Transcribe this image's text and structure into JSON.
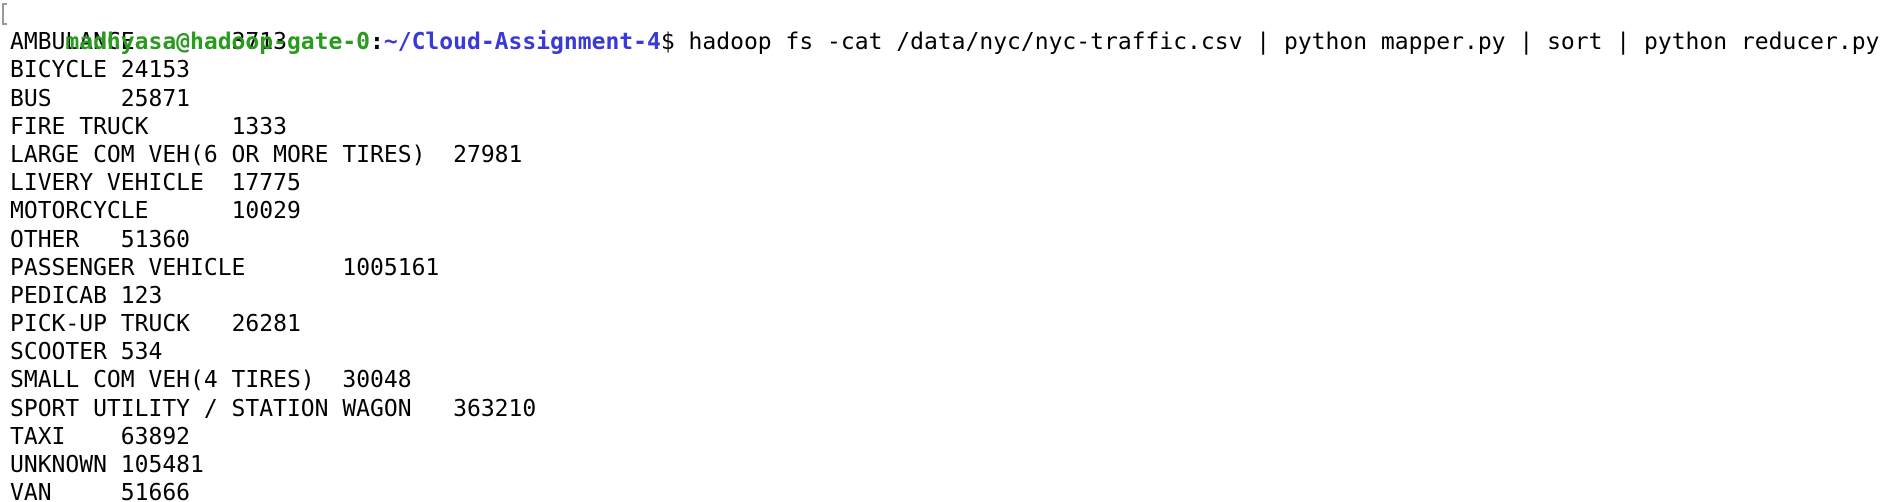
{
  "prompt": {
    "user_host": "madhyasa@hadoop-gate-0",
    "separator": ":",
    "cwd": "~/Cloud-Assignment-4",
    "symbol": "$",
    "command": " hadoop fs -cat /data/nyc/nyc-traffic.csv | python mapper.py | sort | python reducer.py"
  },
  "colors": {
    "user_host": "#2a9b1f",
    "cwd": "#3a3ad6",
    "text": "#000000",
    "background": "#ffffff"
  },
  "output": [
    {
      "label": "AMBULANCE",
      "gap": "       ",
      "value": "3713"
    },
    {
      "label": "BICYCLE",
      "gap": " ",
      "value": "24153"
    },
    {
      "label": "BUS",
      "gap": "     ",
      "value": "25871"
    },
    {
      "label": "FIRE TRUCK",
      "gap": "      ",
      "value": "1333"
    },
    {
      "label": "LARGE COM VEH(6 OR MORE TIRES)",
      "gap": "  ",
      "value": "27981"
    },
    {
      "label": "LIVERY VEHICLE",
      "gap": "  ",
      "value": "17775"
    },
    {
      "label": "MOTORCYCLE",
      "gap": "      ",
      "value": "10029"
    },
    {
      "label": "OTHER",
      "gap": "   ",
      "value": "51360"
    },
    {
      "label": "PASSENGER VEHICLE",
      "gap": "       ",
      "value": "1005161"
    },
    {
      "label": "PEDICAB",
      "gap": " ",
      "value": "123"
    },
    {
      "label": "PICK-UP TRUCK",
      "gap": "   ",
      "value": "26281"
    },
    {
      "label": "SCOOTER",
      "gap": " ",
      "value": "534"
    },
    {
      "label": "SMALL COM VEH(4 TIRES)",
      "gap": "  ",
      "value": "30048"
    },
    {
      "label": "SPORT UTILITY / STATION WAGON",
      "gap": "   ",
      "value": "363210"
    },
    {
      "label": "TAXI",
      "gap": "    ",
      "value": "63892"
    },
    {
      "label": "UNKNOWN",
      "gap": " ",
      "value": "105481"
    },
    {
      "label": "VAN",
      "gap": "     ",
      "value": "51666"
    }
  ]
}
